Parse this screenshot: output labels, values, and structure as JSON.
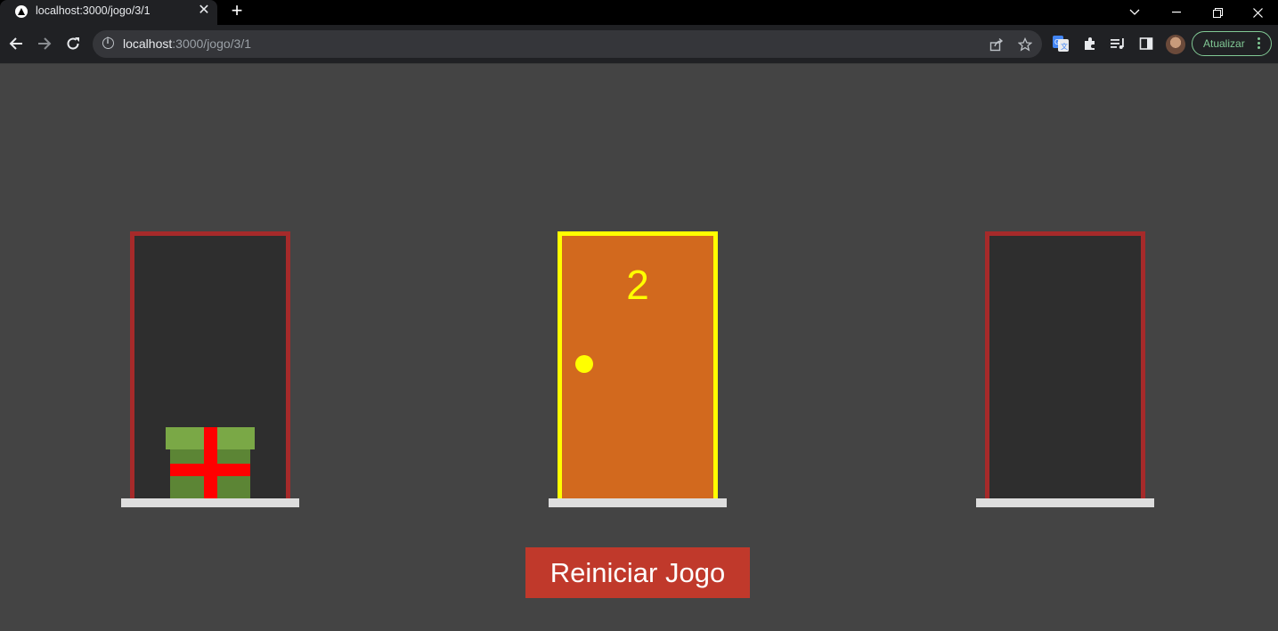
{
  "browser": {
    "tab_title": "localhost:3000/jogo/3/1",
    "url_host": "localhost",
    "url_path": ":3000/jogo/3/1",
    "update_label": "Atualizar"
  },
  "game": {
    "doors": [
      {
        "state": "open",
        "has_gift": true
      },
      {
        "state": "closed",
        "selected": true,
        "number": "2"
      },
      {
        "state": "open",
        "has_gift": false
      }
    ],
    "restart_label": "Reiniciar Jogo"
  },
  "colors": {
    "background": "#444444",
    "frame": "#a62a2a",
    "door": "#d2691e",
    "selected_border": "#ffff00",
    "gift_lid": "#7aa846",
    "gift_body": "#5c8535",
    "ribbon": "#ff0000",
    "restart_button": "#c0392b"
  }
}
